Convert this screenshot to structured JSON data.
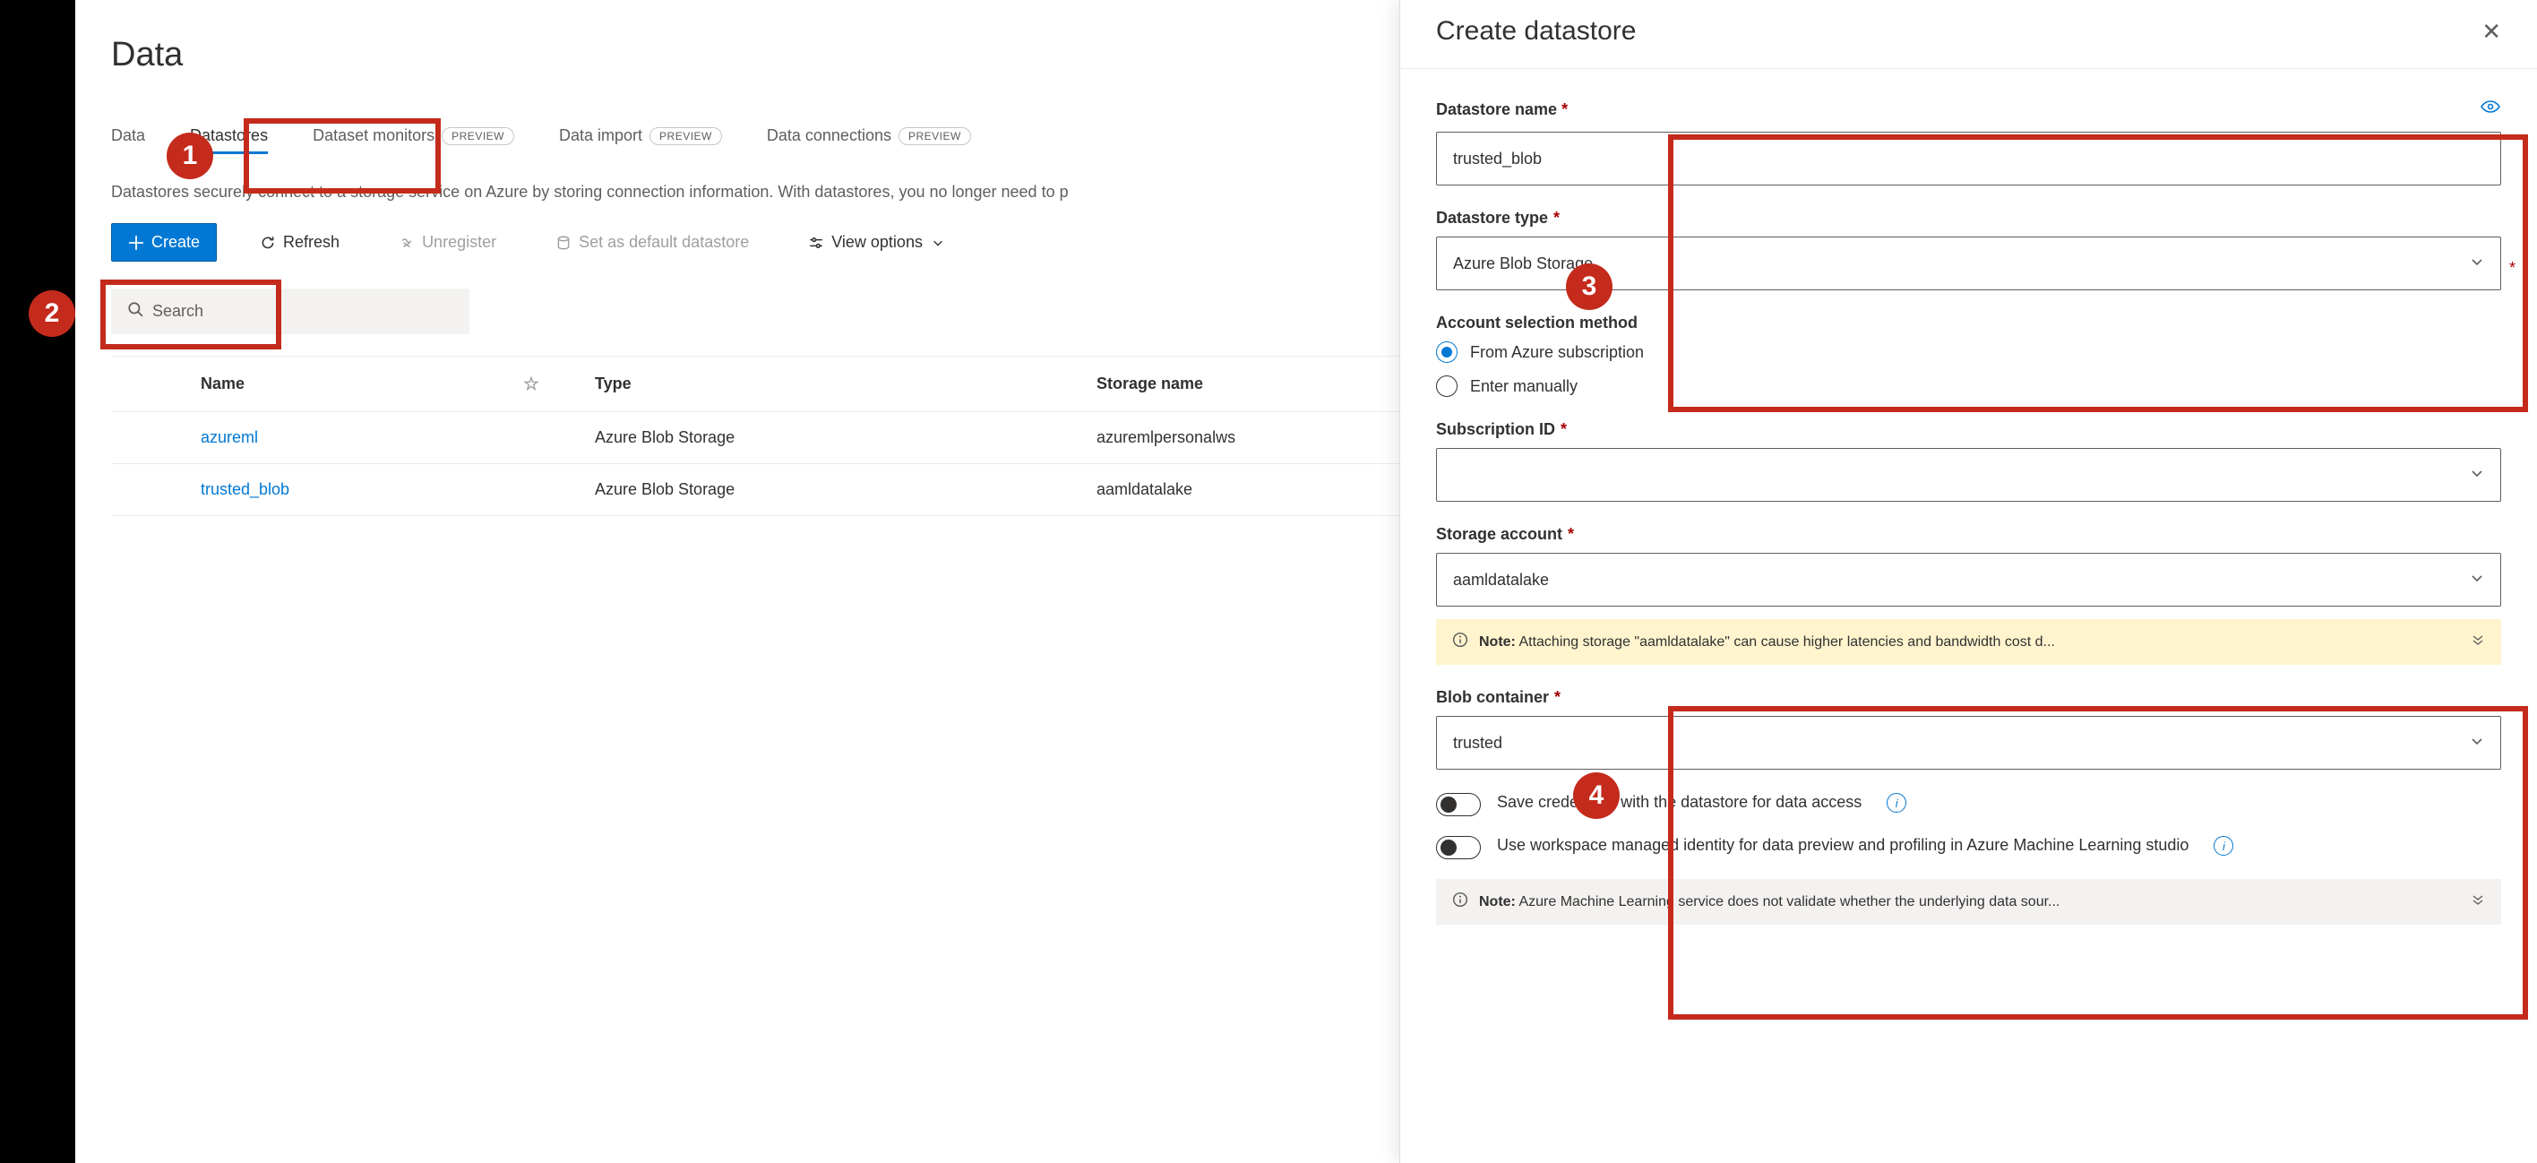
{
  "page": {
    "title": "Data",
    "description": "Datastores securely connect to a storage service on Azure by storing connection information. With datastores, you no longer need to p"
  },
  "tabs": [
    {
      "label": "Data",
      "preview": false
    },
    {
      "label": "Datastores",
      "preview": false,
      "active": true
    },
    {
      "label": "Dataset monitors",
      "preview": true
    },
    {
      "label": "Data import",
      "preview": true
    },
    {
      "label": "Data connections",
      "preview": true
    }
  ],
  "preview_badge": "PREVIEW",
  "toolbar": {
    "create": "Create",
    "refresh": "Refresh",
    "unregister": "Unregister",
    "set_default": "Set as default datastore",
    "view_options": "View options"
  },
  "search": {
    "placeholder": "Search"
  },
  "table": {
    "headers": {
      "name": "Name",
      "type": "Type",
      "storage": "Storage name"
    },
    "rows": [
      {
        "name": "azureml",
        "type": "Azure Blob Storage",
        "storage": "azuremlpersonalws"
      },
      {
        "name": "trusted_blob",
        "type": "Azure Blob Storage",
        "storage": "aamldatalake"
      }
    ]
  },
  "panel": {
    "title": "Create datastore",
    "fields": {
      "name_label": "Datastore name",
      "name_value": "trusted_blob",
      "type_label": "Datastore type",
      "type_value": "Azure Blob Storage",
      "account_method_label": "Account selection method",
      "radio_from_sub": "From Azure subscription",
      "radio_manual": "Enter manually",
      "subscription_label": "Subscription ID",
      "subscription_value": "",
      "storage_label": "Storage account",
      "storage_value": "aamldatalake",
      "storage_note_prefix": "Note:",
      "storage_note_text": " Attaching storage \"aamldatalake\" can cause higher latencies and bandwidth cost d...",
      "blob_label": "Blob container",
      "blob_value": "trusted",
      "toggle1": "Save credentials with the datastore for data access",
      "toggle2": "Use workspace managed identity for data preview and profiling in Azure Machine Learning studio",
      "bottom_note_prefix": "Note:",
      "bottom_note_text": " Azure Machine Learning service does not validate whether the underlying data sour..."
    }
  },
  "annotations": {
    "a1": "1",
    "a2": "2",
    "a3": "3",
    "a4": "4"
  }
}
